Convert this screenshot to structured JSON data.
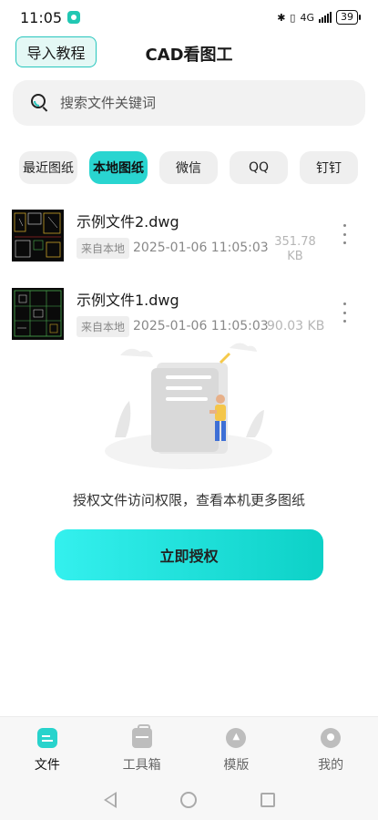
{
  "status_bar": {
    "time": "11:05",
    "network": "4G",
    "battery": "39"
  },
  "header": {
    "import_button": "导入教程",
    "title": "CAD看图工"
  },
  "search": {
    "placeholder": "搜索文件关键词"
  },
  "tabs": [
    {
      "label": "最近图纸",
      "active": false
    },
    {
      "label": "本地图纸",
      "active": true
    },
    {
      "label": "微信",
      "active": false
    },
    {
      "label": "QQ",
      "active": false
    },
    {
      "label": "钉钉",
      "active": false
    }
  ],
  "files": [
    {
      "name": "示例文件2.dwg",
      "source": "来自本地",
      "date": "2025-01-06 11:05:03",
      "size_value": "351.78",
      "size_unit": "KB"
    },
    {
      "name": "示例文件1.dwg",
      "source": "来自本地",
      "date": "2025-01-06 11:05:03",
      "size": "90.03 KB"
    }
  ],
  "permission": {
    "message": "授权文件访问权限，查看本机更多图纸",
    "button": "立即授权"
  },
  "bottom_nav": [
    {
      "label": "文件",
      "icon": "file-icon",
      "active": true
    },
    {
      "label": "工具箱",
      "icon": "toolbox-icon",
      "active": false
    },
    {
      "label": "模版",
      "icon": "template-icon",
      "active": false
    },
    {
      "label": "我的",
      "icon": "profile-icon",
      "active": false
    }
  ],
  "colors": {
    "accent": "#29d5d0",
    "accent_border": "#27c6bd",
    "button_gradient_start": "#34f0ee",
    "button_gradient_end": "#0dd1c7"
  }
}
